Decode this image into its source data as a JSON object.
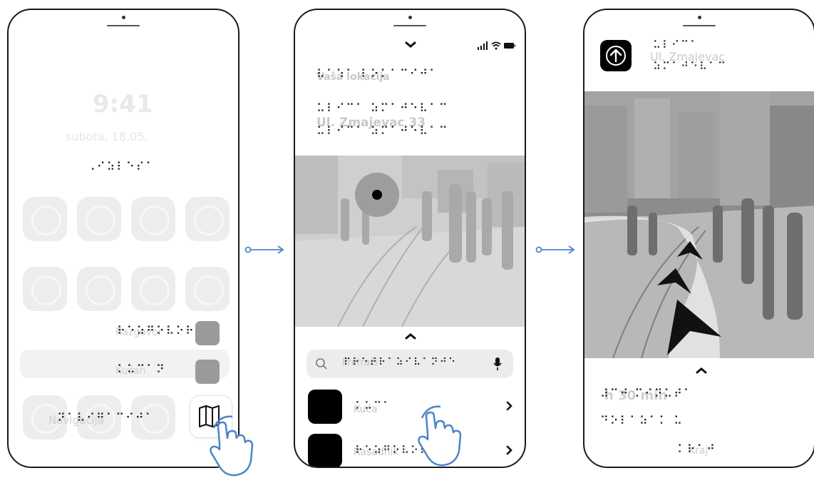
{
  "phone1": {
    "time": "9:41",
    "date": "subota, 18.05.",
    "braille_header": "⠠⠊⠵⠇⠑⠎⠁",
    "braille_row1": "⠗⠑⠵⠛⠕⠧⠕⠗",
    "text_row1": "Razgovor",
    "braille_row2": "⠅⠥⠉⠁⠝",
    "text_row2": "Kućan",
    "braille_row3": "⠝⠁⠧⠊⠛⠁⠉⠊⠚⠁",
    "text_row3": "Navigacija",
    "icon_label": "map-icon"
  },
  "phone2": {
    "braille_location_label": "⠧⠁⠱⠁ ⠇⠕⠅⠁⠉⠊⠚⠁",
    "text_location_label": "Vaša lokacija",
    "braille_address": "⠥⠇⠊⠉⠁ ⠵⠍⠁⠚⠑⠧⠁⠉",
    "text_address": "Ul. Zmajevac 33",
    "search_braille": "⠏⠗⠑⠞⠗⠁⠵⠊⠧⠁⠝⠚⠑",
    "search_text": "Pretraži",
    "item1_braille": "⠅⠥⠉⠁",
    "item1_text": "Kuća",
    "item2_braille": "⠗⠑⠵⠛⠕⠧⠕⠗",
    "item2_text": "Rasadnik"
  },
  "phone3": {
    "braille_street": "⠥⠇⠊⠉⠁",
    "text_street": "Ul. Zmajevac",
    "braille_street2": "⠵⠍⠁⠚⠑⠧⠁⠉",
    "braille_eta": "⠼⠉⠚ ⠍⠊⠝⠥⠞⠁",
    "text_eta": "h 30 min",
    "braille_distance": "⠙⠕⠇⠁⠵⠁⠅ ⠥",
    "braille_end": "⠅⠗⠁⠚",
    "text_end": "Kraj"
  },
  "colors": {
    "accent": "#4a86c8",
    "connector": "#4a86c8"
  }
}
